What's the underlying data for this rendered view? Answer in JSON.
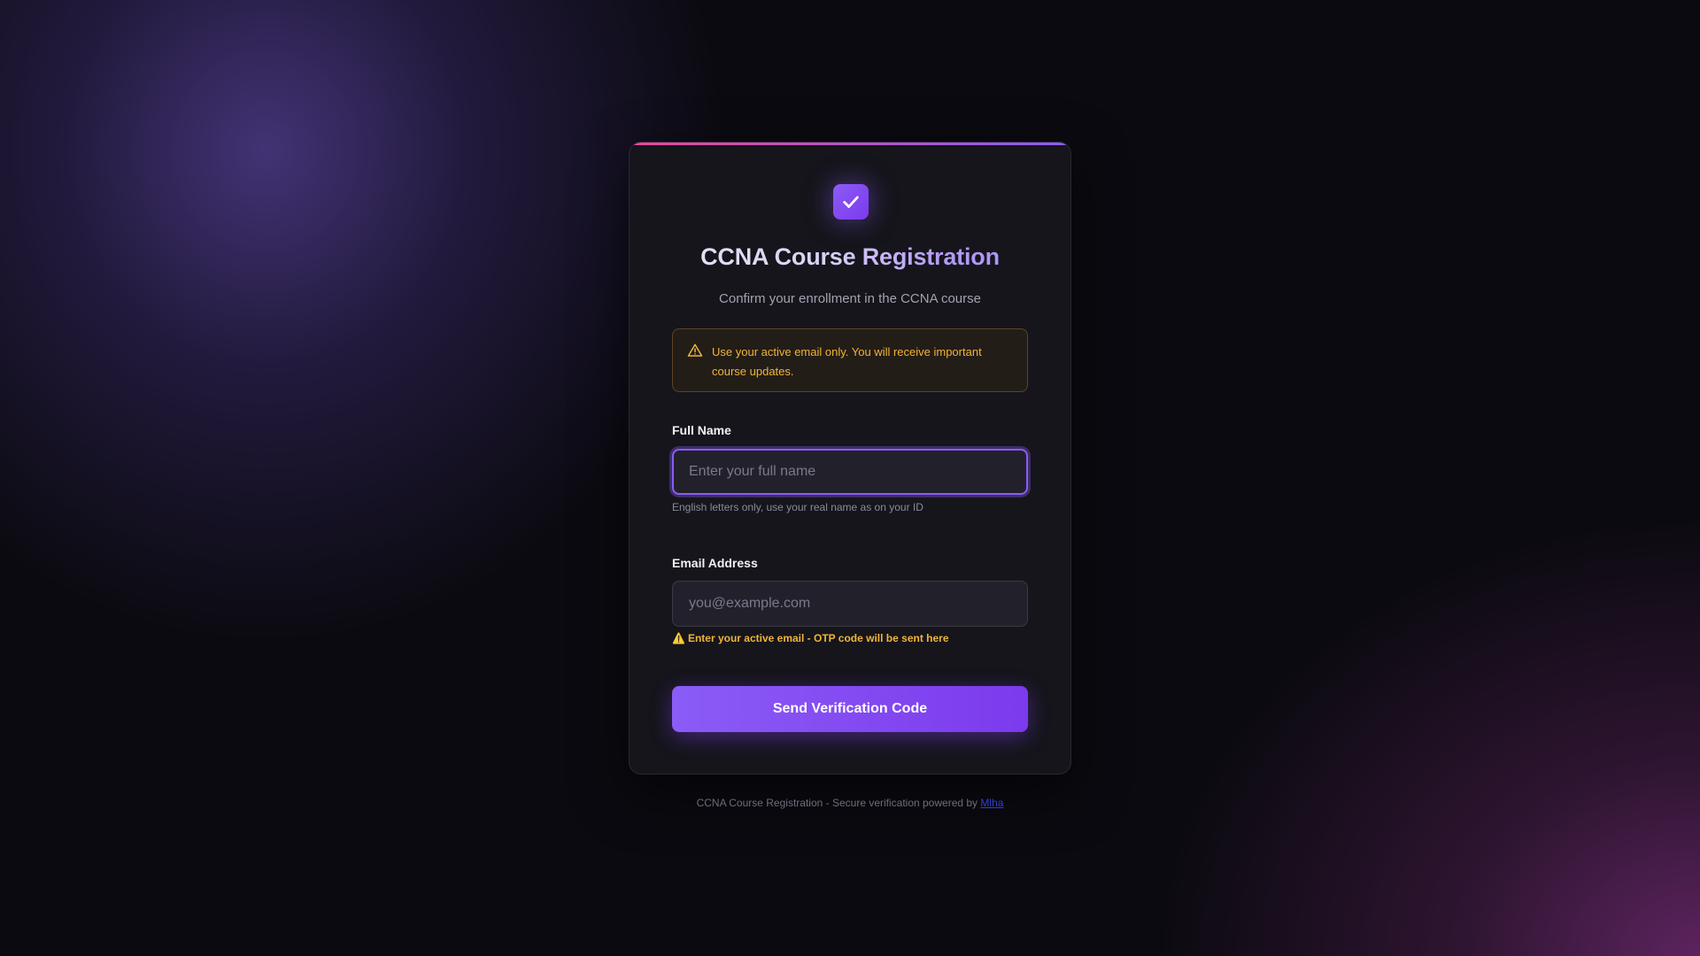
{
  "card": {
    "title": "CCNA Course Registration",
    "subtitle": "Confirm your enrollment in the CCNA course",
    "logo_icon": "check-icon"
  },
  "alert": {
    "icon": "warning-triangle-icon",
    "text": "Use your active email only. You will receive important course updates."
  },
  "form": {
    "full_name": {
      "label": "Full Name",
      "value": "",
      "placeholder": "Enter your full name",
      "hint": "English letters only, use your real name as on your ID"
    },
    "email": {
      "label": "Email Address",
      "value": "",
      "placeholder": "you@example.com",
      "warning_emoji": "⚠️",
      "warning": "Enter your active email - OTP code will be sent here"
    },
    "submit_label": "Send Verification Code"
  },
  "footer": {
    "text": "CCNA Course Registration - Secure verification powered by",
    "link_text": "Mlha"
  },
  "colors": {
    "accent": "#8b5cf6",
    "accent_dark": "#7c3aed",
    "accent_pink": "#ec4899",
    "warning": "#f0b43a",
    "card_bg": "#15151b",
    "page_bg": "#0b0a10"
  }
}
